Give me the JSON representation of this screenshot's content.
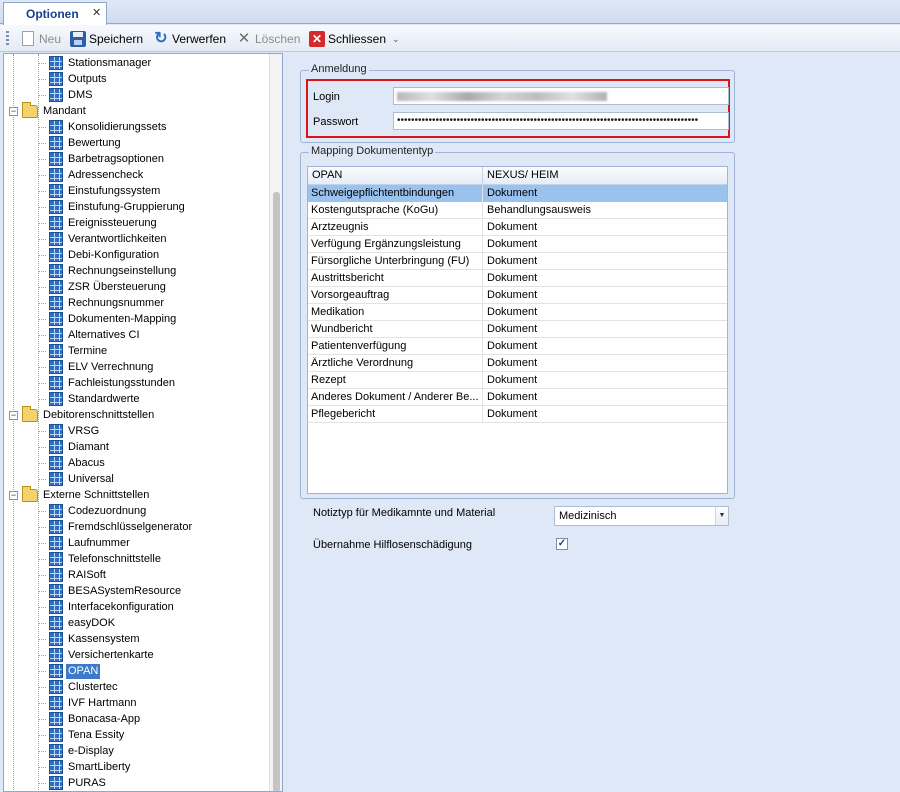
{
  "tab": {
    "title": "Optionen",
    "close": "✕"
  },
  "toolbar": {
    "new_label": "Neu",
    "save_label": "Speichern",
    "discard_label": "Verwerfen",
    "delete_label": "Löschen",
    "close_label": "Schliessen",
    "more": "⌄"
  },
  "tree": {
    "items": [
      {
        "label": "Stationsmanager",
        "level": 2
      },
      {
        "label": "Outputs",
        "level": 2
      },
      {
        "label": "DMS",
        "level": 2
      },
      {
        "label": "Mandant",
        "level": 1
      },
      {
        "label": "Konsolidierungssets",
        "level": 2
      },
      {
        "label": "Bewertung",
        "level": 2
      },
      {
        "label": "Barbetragsoptionen",
        "level": 2
      },
      {
        "label": "Adressencheck",
        "level": 2
      },
      {
        "label": "Einstufungssystem",
        "level": 2
      },
      {
        "label": "Einstufung-Gruppierung",
        "level": 2
      },
      {
        "label": "Ereignissteuerung",
        "level": 2
      },
      {
        "label": "Verantwortlichkeiten",
        "level": 2
      },
      {
        "label": "Debi-Konfiguration",
        "level": 2
      },
      {
        "label": "Rechnungseinstellung",
        "level": 2
      },
      {
        "label": "ZSR Übersteuerung",
        "level": 2
      },
      {
        "label": "Rechnungsnummer",
        "level": 2
      },
      {
        "label": "Dokumenten-Mapping",
        "level": 2
      },
      {
        "label": "Alternatives CI",
        "level": 2
      },
      {
        "label": "Termine",
        "level": 2
      },
      {
        "label": "ELV Verrechnung",
        "level": 2
      },
      {
        "label": "Fachleistungsstunden",
        "level": 2
      },
      {
        "label": "Standardwerte",
        "level": 2
      },
      {
        "label": "Debitorenschnittstellen",
        "level": 1
      },
      {
        "label": "VRSG",
        "level": 2
      },
      {
        "label": "Diamant",
        "level": 2
      },
      {
        "label": "Abacus",
        "level": 2
      },
      {
        "label": "Universal",
        "level": 2
      },
      {
        "label": "Externe Schnittstellen",
        "level": 1
      },
      {
        "label": "Codezuordnung",
        "level": 2
      },
      {
        "label": "Fremdschlüsselgenerator",
        "level": 2
      },
      {
        "label": "Laufnummer",
        "level": 2
      },
      {
        "label": "Telefonschnittstelle",
        "level": 2
      },
      {
        "label": "RAISoft",
        "level": 2
      },
      {
        "label": "BESASystemResource",
        "level": 2
      },
      {
        "label": "Interfacekonfiguration",
        "level": 2
      },
      {
        "label": "easyDOK",
        "level": 2
      },
      {
        "label": "Kassensystem",
        "level": 2
      },
      {
        "label": "Versichertenkarte",
        "level": 2
      },
      {
        "label": "OPAN",
        "level": 2,
        "selected": true
      },
      {
        "label": "Clustertec",
        "level": 2
      },
      {
        "label": "IVF Hartmann",
        "level": 2
      },
      {
        "label": "Bonacasa-App",
        "level": 2
      },
      {
        "label": "Tena Essity",
        "level": 2
      },
      {
        "label": "e-Display",
        "level": 2
      },
      {
        "label": "SmartLiberty",
        "level": 2
      },
      {
        "label": "PURAS",
        "level": 2
      }
    ]
  },
  "anmeldung": {
    "title": "Anmeldung",
    "login_label": "Login",
    "password_label": "Passwort",
    "password_value": "••••••••••••••••••••••••••••••••••••••••••••••••••••••••••••••••••••••••••••••••••••••"
  },
  "mapping": {
    "title": "Mapping Dokumententyp",
    "col1": "OPAN",
    "col2": "NEXUS/ HEIM",
    "rows": [
      {
        "opan": "Schweigepflichtentbindungen",
        "nexus": "Dokument",
        "selected": true
      },
      {
        "opan": "Kostengutsprache (KoGu)",
        "nexus": "Behandlungsausweis"
      },
      {
        "opan": "Arztzeugnis",
        "nexus": "Dokument"
      },
      {
        "opan": "Verfügung Ergänzungsleistung",
        "nexus": "Dokument"
      },
      {
        "opan": "Fürsorgliche Unterbringung (FU)",
        "nexus": "Dokument"
      },
      {
        "opan": "Austrittsbericht",
        "nexus": "Dokument"
      },
      {
        "opan": "Vorsorgeauftrag",
        "nexus": "Dokument"
      },
      {
        "opan": "Medikation",
        "nexus": "Dokument"
      },
      {
        "opan": "Wundbericht",
        "nexus": "Dokument"
      },
      {
        "opan": "Patientenverfügung",
        "nexus": "Dokument"
      },
      {
        "opan": "Ärztliche Verordnung",
        "nexus": "Dokument"
      },
      {
        "opan": "Rezept",
        "nexus": "Dokument"
      },
      {
        "opan": "Anderes Dokument / Anderer Be...",
        "nexus": "Dokument"
      },
      {
        "opan": "Pflegebericht",
        "nexus": "Dokument"
      }
    ]
  },
  "notiz": {
    "label": "Notiztyp für Medikamnte und Material",
    "value": "Medizinisch"
  },
  "hilflosen": {
    "label": "Übernahme Hilflosenschädigung",
    "checked": "✓"
  }
}
